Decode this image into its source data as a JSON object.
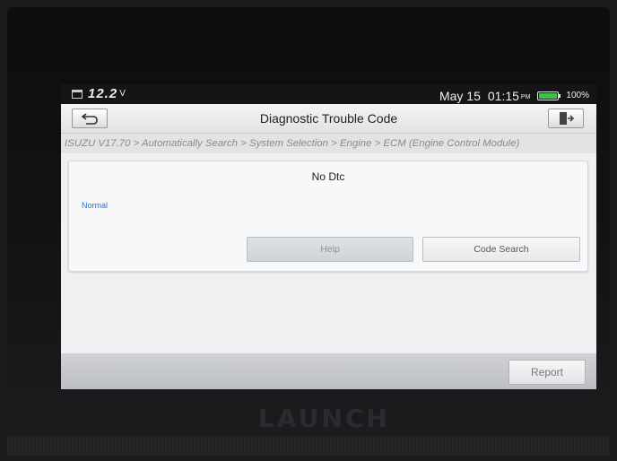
{
  "status_bar": {
    "voltage": "12.2",
    "voltage_unit": "V",
    "date": "May 15",
    "time": "01:15",
    "ampm": "PM",
    "battery_percent": "100%",
    "battery_level": 1.0,
    "battery_color": "#37c24a"
  },
  "header": {
    "title": "Diagnostic Trouble Code",
    "back_icon": "back-arrow-icon",
    "exit_icon": "exit-door-icon"
  },
  "breadcrumb": "ISUZU V17.70 > Automatically Search > System Selection > Engine > ECM (Engine Control Module)",
  "dtc_panel": {
    "message": "No Dtc",
    "status": "Normal",
    "status_color": "#2b6fd6",
    "help_label": "Help",
    "code_search_label": "Code Search"
  },
  "footer": {
    "report_label": "Report"
  },
  "device": {
    "brand": "LAUNCH"
  }
}
